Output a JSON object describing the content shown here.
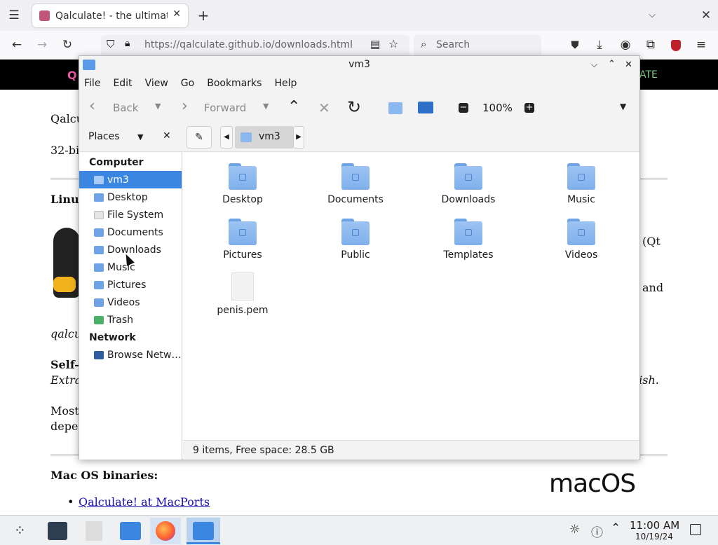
{
  "browser": {
    "tab_title": "Qalculate! - the ultimate c",
    "url": "https://qalculate.github.io/downloads.html",
    "search_placeholder": "Search"
  },
  "webpage": {
    "header_left": "Q",
    "header_right": "ATE",
    "text_lines": [
      "Qalcu",
      "32-bi",
      "Linu",
      "(Qt",
      "and",
      "qalcu",
      "Self-c",
      "Extra",
      "lish.",
      "Most",
      "depe",
      "Mac OS binaries:",
      "Qalculate! at MacPorts"
    ],
    "macos_logo": "macOS"
  },
  "file_manager": {
    "window_title": "vm3",
    "menu": [
      "File",
      "Edit",
      "View",
      "Go",
      "Bookmarks",
      "Help"
    ],
    "toolbar": {
      "back": "Back",
      "forward": "Forward",
      "zoom": "100%"
    },
    "side_panel_label": "Places",
    "location_crumb": "vm3",
    "sidebar": {
      "computer_heading": "Computer",
      "computer_items": [
        "vm3",
        "Desktop",
        "File System",
        "Documents",
        "Downloads",
        "Music",
        "Pictures",
        "Videos",
        "Trash"
      ],
      "network_heading": "Network",
      "network_items": [
        "Browse Netw…"
      ]
    },
    "files": [
      {
        "name": "Desktop",
        "type": "folder"
      },
      {
        "name": "Documents",
        "type": "folder"
      },
      {
        "name": "Downloads",
        "type": "folder"
      },
      {
        "name": "Music",
        "type": "folder"
      },
      {
        "name": "Pictures",
        "type": "folder"
      },
      {
        "name": "Public",
        "type": "folder"
      },
      {
        "name": "Templates",
        "type": "folder"
      },
      {
        "name": "Videos",
        "type": "folder"
      },
      {
        "name": "penis.pem",
        "type": "file"
      }
    ],
    "status": "9 items, Free space: 28.5 GB"
  },
  "clock": {
    "time": "11:00 AM",
    "date": "10/19/24"
  },
  "colors": {
    "accent": "#3b86e0",
    "folder": "#8ab8ef"
  }
}
